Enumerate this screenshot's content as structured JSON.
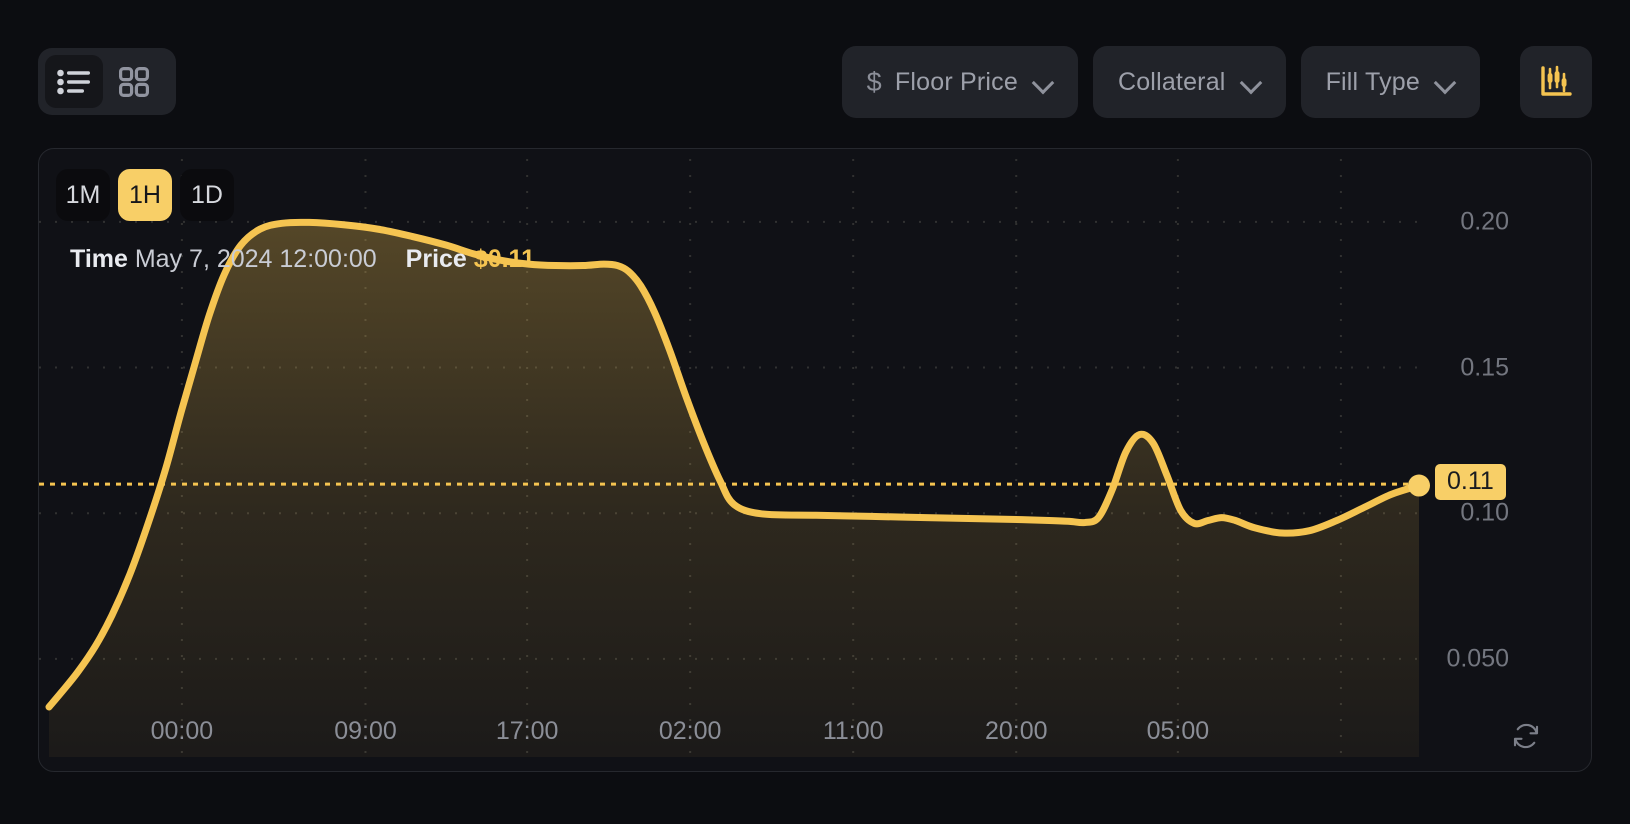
{
  "toolbar": {
    "view_toggle": {
      "list_view_label": "list-view",
      "grid_view_label": "grid-view",
      "active": "list"
    },
    "filters": [
      {
        "icon": "dollar-icon",
        "symbol": "$",
        "label": "Floor Price",
        "has_chevron": true
      },
      {
        "icon": null,
        "symbol": "",
        "label": "Collateral",
        "has_chevron": true
      },
      {
        "icon": null,
        "symbol": "",
        "label": "Fill Type",
        "has_chevron": true
      }
    ],
    "chart_toggle_button": {
      "icon": "candlestick-chart-icon",
      "color": "#F5C451"
    }
  },
  "chart_panel": {
    "ranges": [
      {
        "label": "1M",
        "active": false
      },
      {
        "label": "1H",
        "active": true
      },
      {
        "label": "1D",
        "active": false
      }
    ],
    "readout": {
      "time_key": "Time",
      "time_value": "May 7, 2024 12:00:00",
      "price_key": "Price",
      "price_value": "$0.11"
    },
    "current_price_badge": "0.11",
    "refresh_icon": "refresh-icon"
  },
  "colors": {
    "accent": "#F5C451",
    "accent_bright": "#F8CF67",
    "panel_bg": "#101116",
    "page_bg": "#0c0d11",
    "chip_bg": "#212329",
    "muted_text": "#8b8e97"
  },
  "chart_data": {
    "type": "area",
    "title": "",
    "xlabel": "",
    "ylabel": "",
    "ylim": [
      0.028,
      0.225
    ],
    "xlim": [
      0,
      100
    ],
    "grid": true,
    "legend": null,
    "y_ticks": [
      {
        "label": "0.20",
        "value": 0.2
      },
      {
        "label": "0.15",
        "value": 0.15
      },
      {
        "label": "0.10",
        "value": 0.1
      },
      {
        "label": "0.050",
        "value": 0.05
      }
    ],
    "x_ticks": [
      {
        "label": "00:00",
        "pos": 0.097
      },
      {
        "label": "09:00",
        "pos": 0.231
      },
      {
        "label": "17:00",
        "pos": 0.349
      },
      {
        "label": "02:00",
        "pos": 0.468
      },
      {
        "label": "11:00",
        "pos": 0.587
      },
      {
        "label": "20:00",
        "pos": 0.706
      },
      {
        "label": "05:00",
        "pos": 0.824
      },
      {
        "label": "",
        "pos": 0.943
      }
    ],
    "marker_line": {
      "value": 0.11,
      "style": "dotted",
      "color": "#F5C451"
    },
    "end_point": {
      "value": 0.11,
      "label": "0.11"
    },
    "series": [
      {
        "name": "Floor Price",
        "color": "#F5C451",
        "fill": "gradient",
        "x": [
          0.0,
          0.9,
          2.1,
          3.4,
          4.6,
          5.9,
          7.2,
          8.5,
          9.6,
          10.7,
          11.7,
          12.8,
          14.0,
          15.4,
          17.0,
          19.0,
          21.5,
          24.0,
          26.5,
          29.0,
          31.0,
          33.0,
          35.0,
          37.0,
          39.0,
          40.5,
          41.5,
          42.3,
          43.2,
          44.2,
          45.3,
          46.5,
          47.8,
          49.0,
          50.0,
          52.0,
          56.0,
          60.0,
          64.0,
          68.0,
          71.0,
          73.0,
          74.5,
          75.6,
          76.6,
          77.6,
          78.6,
          79.6,
          80.6,
          81.6,
          82.6,
          83.6,
          84.6,
          85.6,
          86.6,
          88.0,
          90.0,
          92.0,
          94.0,
          96.0,
          98.0,
          100.0
        ],
        "y": [
          0.0335,
          0.0385,
          0.0455,
          0.0545,
          0.065,
          0.079,
          0.096,
          0.115,
          0.134,
          0.152,
          0.168,
          0.182,
          0.192,
          0.1975,
          0.1995,
          0.1998,
          0.199,
          0.1975,
          0.195,
          0.192,
          0.189,
          0.1868,
          0.1855,
          0.185,
          0.185,
          0.1855,
          0.185,
          0.183,
          0.178,
          0.169,
          0.156,
          0.14,
          0.124,
          0.111,
          0.103,
          0.0998,
          0.0993,
          0.0989,
          0.0985,
          0.0981,
          0.0978,
          0.0975,
          0.0972,
          0.0968,
          0.0985,
          0.108,
          0.121,
          0.127,
          0.124,
          0.113,
          0.101,
          0.0965,
          0.0975,
          0.0985,
          0.0975,
          0.095,
          0.0932,
          0.094,
          0.0975,
          0.102,
          0.1065,
          0.1095
        ]
      }
    ]
  }
}
